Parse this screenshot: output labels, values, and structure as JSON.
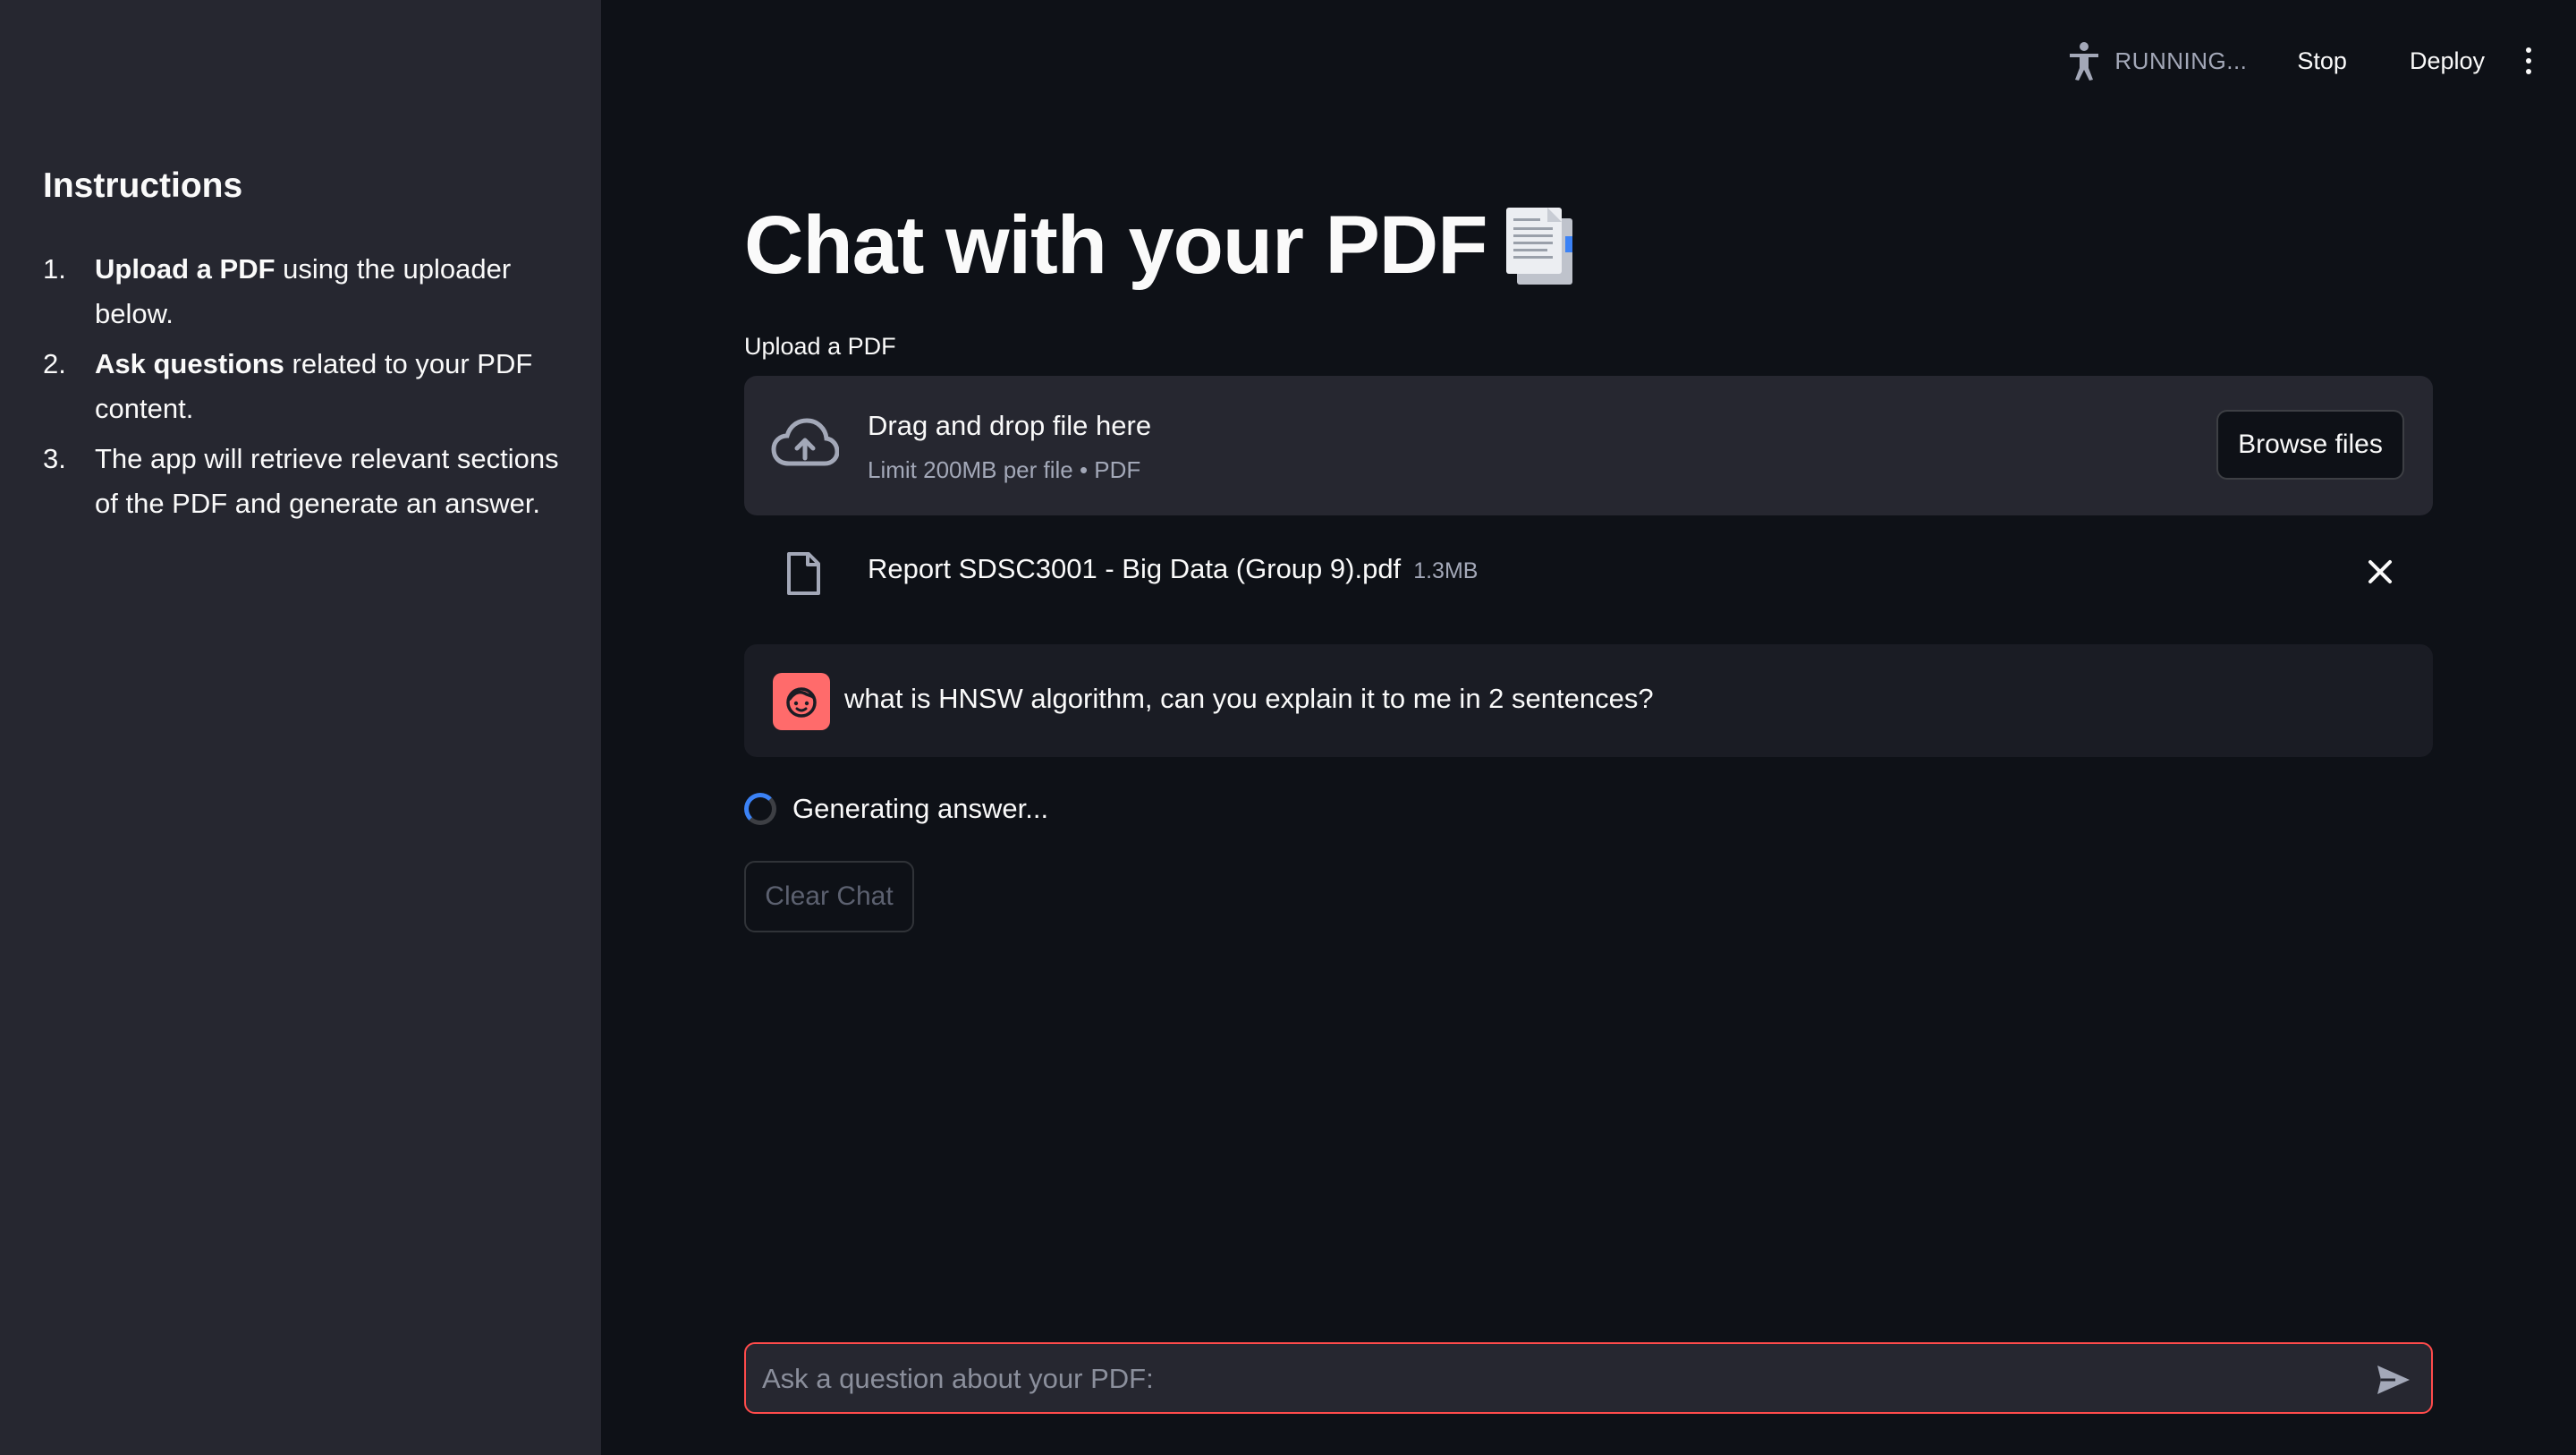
{
  "sidebar": {
    "heading": "Instructions",
    "items": [
      {
        "num": "1.",
        "bold": "Upload a PDF",
        "rest": " using the uploader below."
      },
      {
        "num": "2.",
        "bold": "Ask questions",
        "rest": " related to your PDF content."
      },
      {
        "num": "3.",
        "bold": "",
        "rest": "The app will retrieve relevant sections of the PDF and generate an answer."
      }
    ]
  },
  "toolbar": {
    "status_text": "RUNNING...",
    "stop_label": "Stop",
    "deploy_label": "Deploy",
    "status_icon": "accessibility-running-icon",
    "menu_icon": "kebab-menu-icon"
  },
  "main": {
    "title": "Chat with your PDF",
    "title_emoji": "page-facing-up-emoji",
    "upload_label": "Upload a PDF",
    "dropzone": {
      "main_text": "Drag and drop file here",
      "sub_text": "Limit 200MB per file • PDF",
      "browse_label": "Browse files"
    },
    "file": {
      "name": "Report SDSC3001 - Big Data (Group 9).pdf",
      "size": "1.3MB"
    },
    "message": {
      "text": "what is HNSW algorithm, can you explain it to me in 2 sentences?"
    },
    "spinner_text": "Generating answer...",
    "clear_label": "Clear Chat",
    "input_placeholder": "Ask a question about your PDF:"
  },
  "colors": {
    "background": "#0e1117",
    "sidebar": "#262730",
    "accent": "#ff4b4b",
    "avatar": "#ff6b6b",
    "spinner": "#3b82f6"
  }
}
